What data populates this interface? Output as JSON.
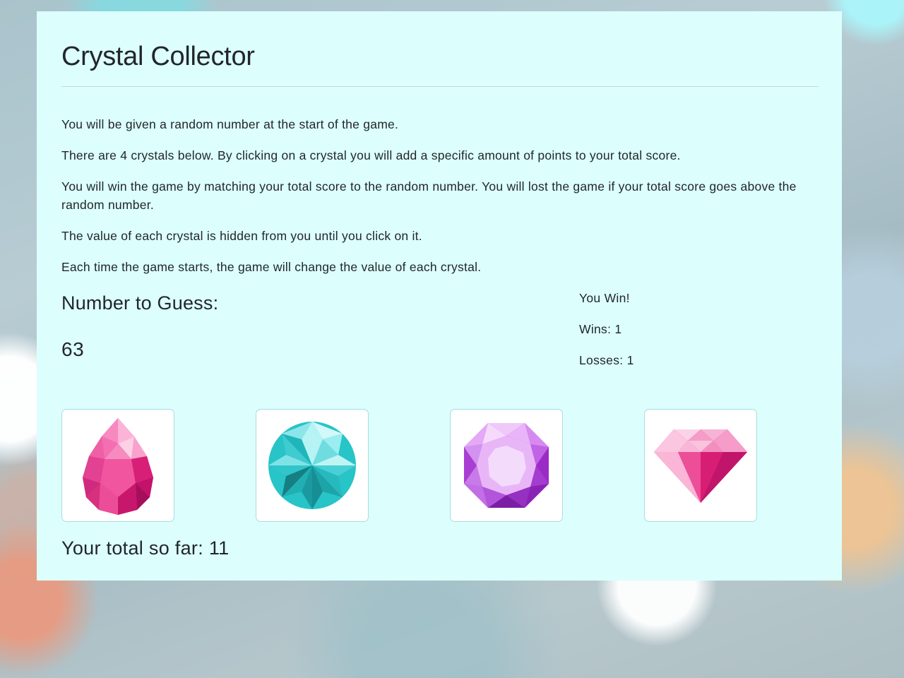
{
  "game": {
    "title": "Crystal Collector",
    "instructions": [
      "You will be given a random number at the start of the game.",
      "There are 4 crystals below. By clicking on a crystal you will add a specific amount of points to your total score.",
      "You will win the game by matching your total score to the random number. You will lost the game if your total score goes above the random number.",
      "The value of each crystal is hidden from you until you click on it.",
      "Each time the game starts, the game will change the value of each crystal."
    ],
    "guess_label": "Number to Guess:",
    "target_number": "63",
    "status_message": "You Win!",
    "wins": "Wins: 1",
    "losses": "Losses: 1",
    "total_label": "Your total so far: ",
    "total_value": "11"
  },
  "crystals": [
    {
      "name": "pink-teardrop-crystal",
      "color": "#e8348c"
    },
    {
      "name": "teal-round-crystal",
      "color": "#27c4c8"
    },
    {
      "name": "purple-octagon-crystal",
      "color": "#b24cd9"
    },
    {
      "name": "pink-diamond-crystal",
      "color": "#e3277f"
    }
  ]
}
